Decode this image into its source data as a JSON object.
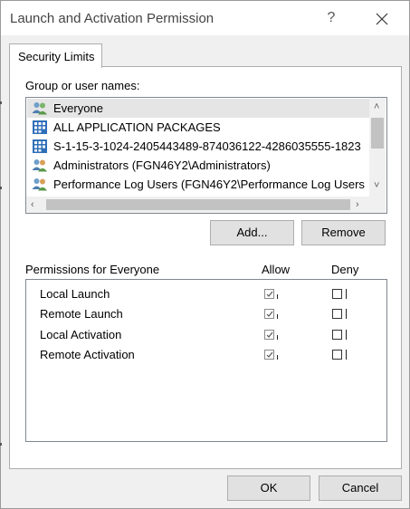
{
  "window": {
    "title": "Launch and Activation Permission",
    "help_glyph": "?"
  },
  "tabs": [
    {
      "label": "Security Limits",
      "selected": true
    }
  ],
  "users_section": {
    "label": "Group or user names:",
    "items": [
      {
        "name": "Everyone",
        "icon": "group-icon",
        "selected": true
      },
      {
        "name": "ALL APPLICATION PACKAGES",
        "icon": "app-packages-icon",
        "selected": false
      },
      {
        "name": "S-1-15-3-1024-2405443489-874036122-4286035555-1823",
        "icon": "app-packages-icon",
        "selected": false
      },
      {
        "name": "Administrators (FGN46Y2\\Administrators)",
        "icon": "group-icon",
        "selected": false
      },
      {
        "name": "Performance Log Users (FGN46Y2\\Performance Log Users",
        "icon": "group-icon",
        "selected": false
      }
    ],
    "add_button": "Add...",
    "remove_button": "Remove"
  },
  "permissions_section": {
    "label": "Permissions for Everyone",
    "allow_header": "Allow",
    "deny_header": "Deny",
    "rows": [
      {
        "name": "Local Launch",
        "allow": true,
        "deny": false
      },
      {
        "name": "Remote Launch",
        "allow": true,
        "deny": false
      },
      {
        "name": "Local Activation",
        "allow": true,
        "deny": false
      },
      {
        "name": "Remote Activation",
        "allow": true,
        "deny": false
      }
    ]
  },
  "footer": {
    "ok_button": "OK",
    "cancel_button": "Cancel"
  },
  "colors": {
    "window_bg": "#f0f0f0",
    "panel_bg": "#ffffff",
    "selection": "#e5e5e5",
    "button_bg": "#e1e1e1"
  }
}
